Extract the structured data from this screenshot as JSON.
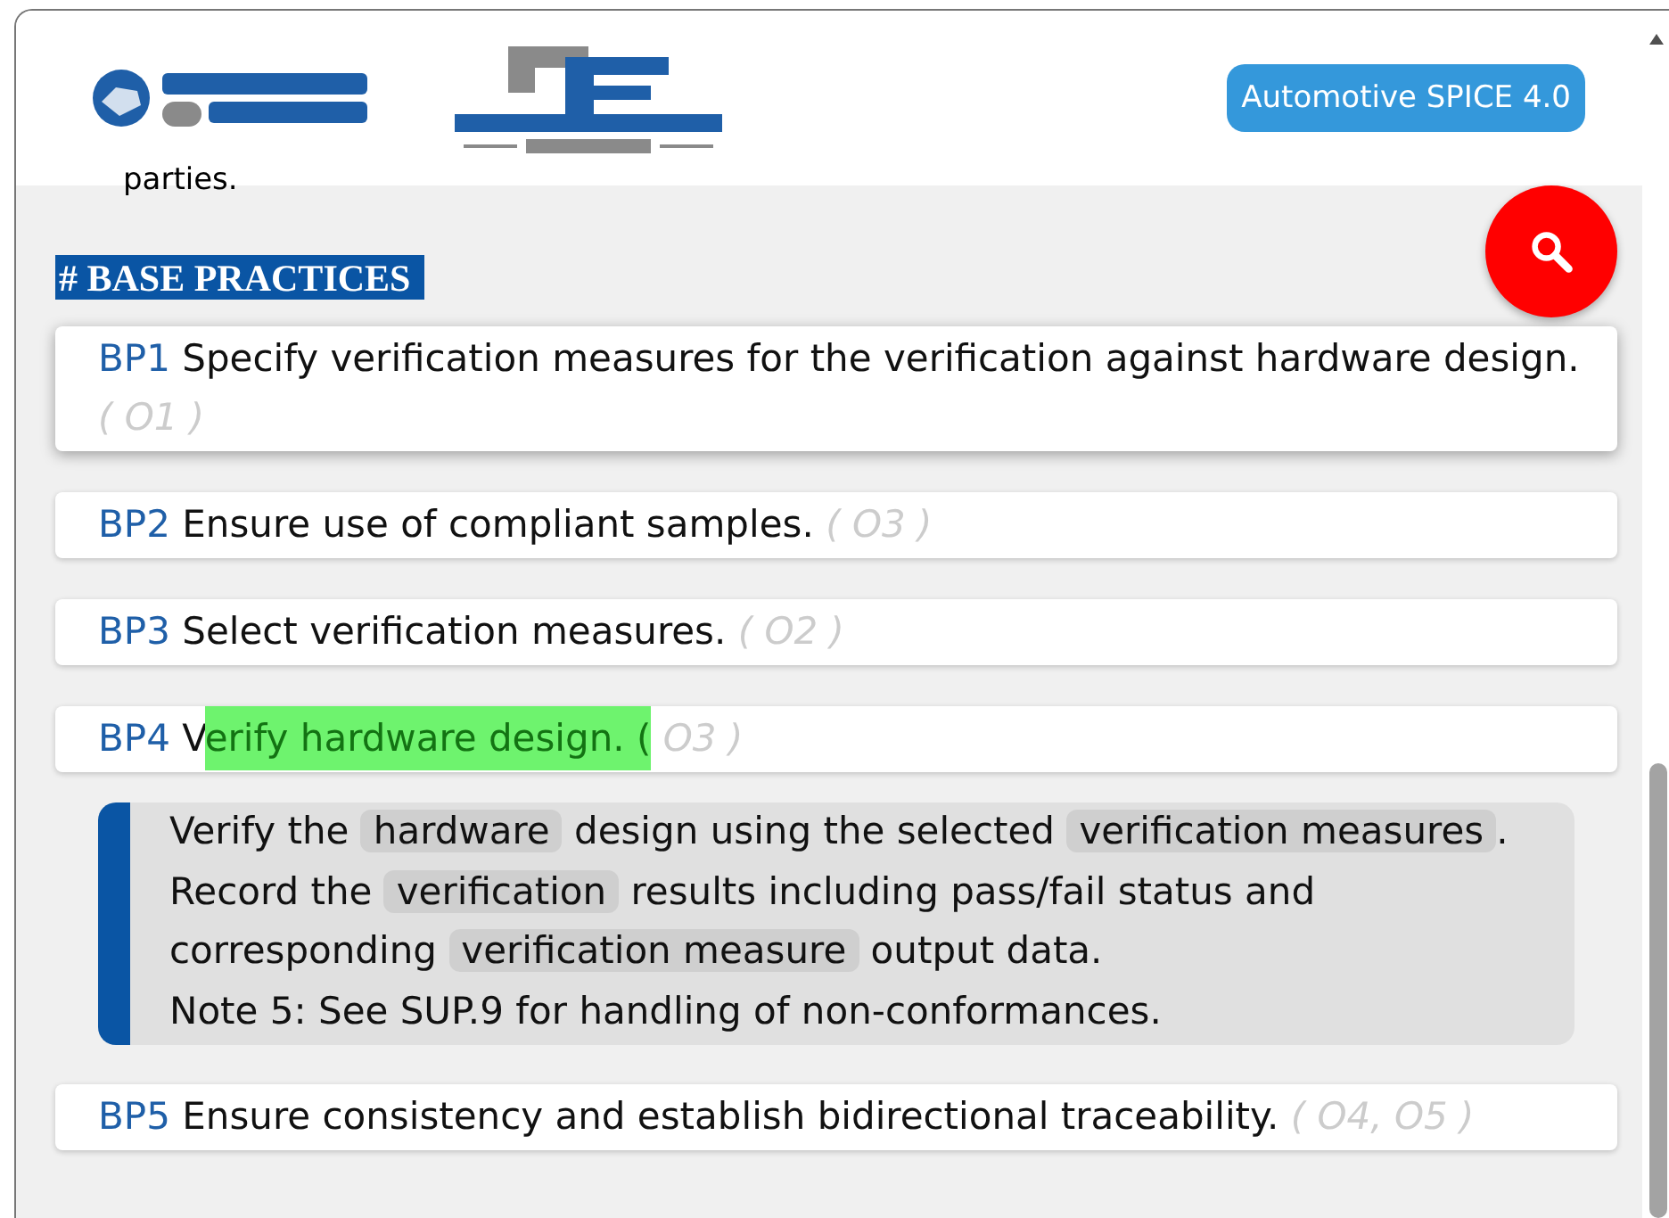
{
  "header": {
    "badge": "Automotive SPICE 4.0"
  },
  "cut_text": "parties.",
  "section_heading": "# BASE PRACTICES",
  "practices": [
    {
      "id": "BP1",
      "segments": [
        {
          "text": "Specify verification measures for the verification against hardware design.",
          "highlighted": false
        }
      ],
      "outcomes": "( O1 )",
      "hovered": true
    },
    {
      "id": "BP2",
      "segments": [
        {
          "text": "Ensure use of compliant samples.",
          "highlighted": false
        }
      ],
      "outcomes": "( O3 )",
      "hovered": false
    },
    {
      "id": "BP3",
      "segments": [
        {
          "text": "Select verification measures.",
          "highlighted": false
        }
      ],
      "outcomes": "( O2 )",
      "hovered": false
    },
    {
      "id": "BP4",
      "segments": [
        {
          "text": "V",
          "highlighted": false
        },
        {
          "text": "erify hardware design. (",
          "highlighted": true
        }
      ],
      "outcomes": "O3 )",
      "hovered": false,
      "description": [
        {
          "text": "Verify the ",
          "kind": "plain"
        },
        {
          "text": "hardware",
          "kind": "term"
        },
        {
          "text": " design using the selected ",
          "kind": "plain"
        },
        {
          "text": "verification measures",
          "kind": "term"
        },
        {
          "text": ". Record the ",
          "kind": "plain"
        },
        {
          "text": "verification",
          "kind": "term"
        },
        {
          "text": " results including pass/fail status and corresponding ",
          "kind": "plain"
        },
        {
          "text": "verification measure",
          "kind": "term"
        },
        {
          "text": " output data.",
          "kind": "plain"
        }
      ],
      "note": "Note 5: See SUP.9 for handling of non-conformances."
    },
    {
      "id": "BP5",
      "segments": [
        {
          "text": "Ensure consistency and establish bidirectional traceability.",
          "highlighted": false
        }
      ],
      "outcomes": "( O4, O5 )",
      "hovered": false
    }
  ]
}
